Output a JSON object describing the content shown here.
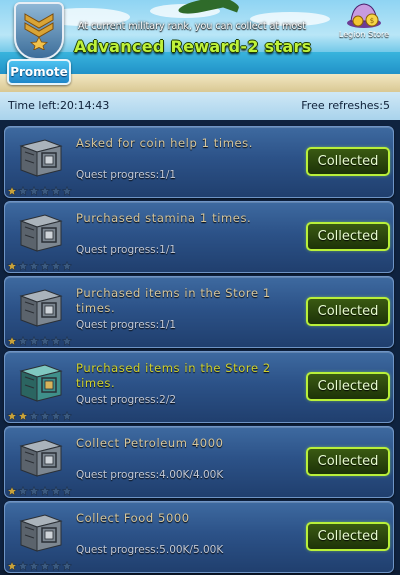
{
  "header": {
    "notice": "At current military rank, you can collect at most",
    "reward_title": "Advanced Reward-2 stars",
    "promote_label": "Promote",
    "legion_store_label": "Legion Store"
  },
  "info": {
    "time_left": "Time left:20:14:43",
    "free_refreshes": "Free refreshes:5"
  },
  "quests": [
    {
      "title": "Asked for coin help 1 times.",
      "progress": "Quest progress:1/1",
      "stars": 1,
      "button": "Collected",
      "highlight": false,
      "crate_icon": "gray-crate-icon"
    },
    {
      "title": "Purchased stamina 1 times.",
      "progress": "Quest progress:1/1",
      "stars": 1,
      "button": "Collected",
      "highlight": false,
      "crate_icon": "gray-crate-icon"
    },
    {
      "title": "Purchased items in the Store 1 times.",
      "progress": "Quest progress:1/1",
      "stars": 1,
      "button": "Collected",
      "highlight": false,
      "crate_icon": "gray-crate-icon"
    },
    {
      "title": "Purchased items in the Store 2 times.",
      "progress": "Quest progress:2/2",
      "stars": 2,
      "button": "Collected",
      "highlight": true,
      "crate_icon": "teal-crate-icon"
    },
    {
      "title": "Collect Petroleum 4000",
      "progress": "Quest progress:4.00K/4.00K",
      "stars": 1,
      "button": "Collected",
      "highlight": false,
      "crate_icon": "gray-crate-icon"
    },
    {
      "title": "Collect Food 5000",
      "progress": "Quest progress:5.00K/5.00K",
      "stars": 1,
      "button": "Collected",
      "highlight": false,
      "crate_icon": "gray-crate-icon"
    }
  ],
  "max_stars": 6,
  "colors": {
    "accent_green": "#b9f03a",
    "title_text": "#d7c79c",
    "highlight_text": "#d1d32e",
    "star_filled": "#c8a23a",
    "star_empty": "#3b5a80"
  }
}
